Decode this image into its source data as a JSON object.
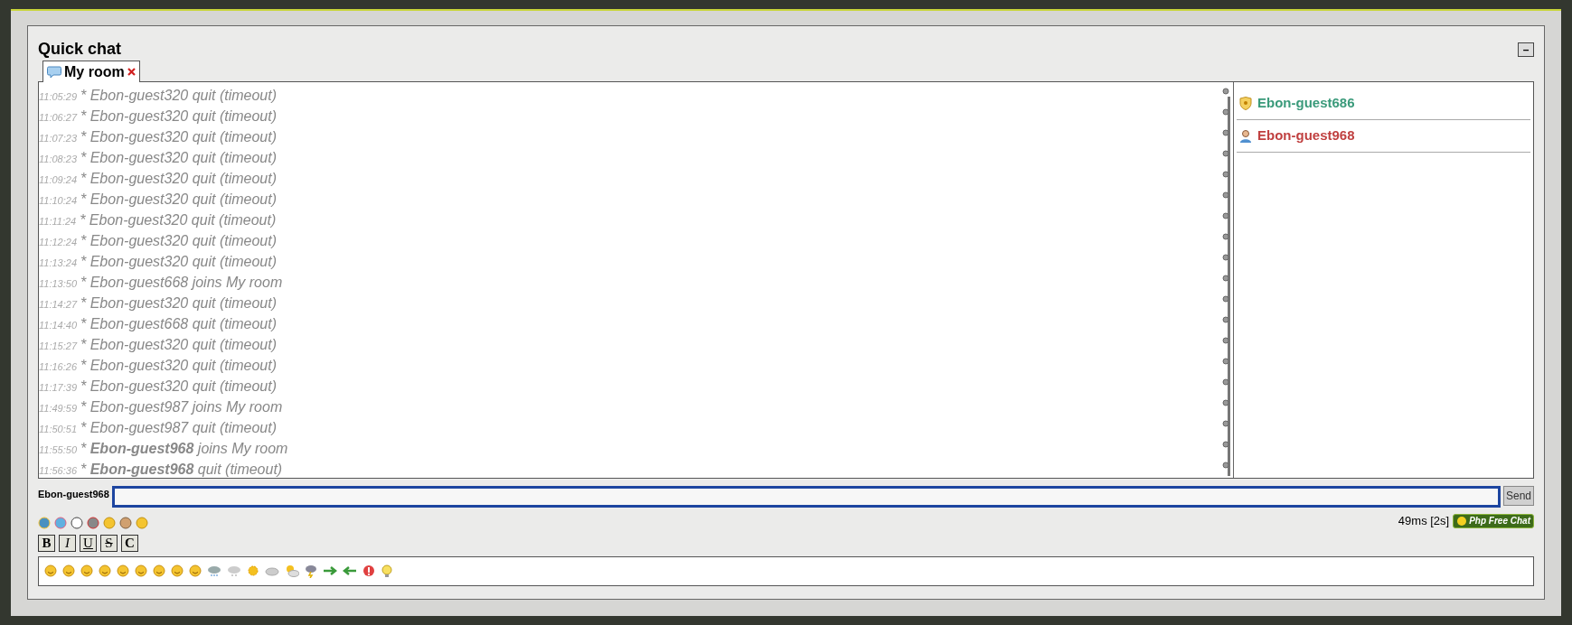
{
  "window": {
    "title": "Quick chat",
    "minimize": "–"
  },
  "tabs": [
    {
      "label": "My room",
      "selected": true
    }
  ],
  "messages": [
    {
      "time": "11:05:29",
      "text": "* Ebon-guest320 quit (timeout)"
    },
    {
      "time": "11:06:27",
      "text": "* Ebon-guest320 quit (timeout)"
    },
    {
      "time": "11:07:23",
      "text": "* Ebon-guest320 quit (timeout)"
    },
    {
      "time": "11:08:23",
      "text": "* Ebon-guest320 quit (timeout)"
    },
    {
      "time": "11:09:24",
      "text": "* Ebon-guest320 quit (timeout)"
    },
    {
      "time": "11:10:24",
      "text": "* Ebon-guest320 quit (timeout)"
    },
    {
      "time": "11:11:24",
      "text": "* Ebon-guest320 quit (timeout)"
    },
    {
      "time": "11:12:24",
      "text": "* Ebon-guest320 quit (timeout)"
    },
    {
      "time": "11:13:24",
      "text": "* Ebon-guest320 quit (timeout)"
    },
    {
      "time": "11:13:50",
      "text": "* Ebon-guest668 joins My room"
    },
    {
      "time": "11:14:27",
      "text": "* Ebon-guest320 quit (timeout)"
    },
    {
      "time": "11:14:40",
      "text": "* Ebon-guest668 quit (timeout)"
    },
    {
      "time": "11:15:27",
      "text": "* Ebon-guest320 quit (timeout)"
    },
    {
      "time": "11:16:26",
      "text": "* Ebon-guest320 quit (timeout)"
    },
    {
      "time": "11:17:39",
      "text": "* Ebon-guest320 quit (timeout)"
    },
    {
      "time": "11:49:59",
      "text": "* Ebon-guest987 joins My room"
    },
    {
      "time": "11:50:51",
      "text": "* Ebon-guest987 quit (timeout)"
    },
    {
      "time": "11:55:50",
      "text": "* **Ebon-guest968** joins My room"
    },
    {
      "time": "11:56:36",
      "text": "* **Ebon-guest968** quit (timeout)"
    }
  ],
  "users": [
    {
      "name": "Ebon-guest686",
      "kind": "admin",
      "color": "#3a9a7a"
    },
    {
      "name": "Ebon-guest968",
      "kind": "user",
      "color": "#c04040"
    }
  ],
  "input": {
    "nickname": "Ebon-guest968",
    "send": "Send"
  },
  "status": {
    "ping": "49ms [2s]",
    "logo": "Php Free Chat"
  },
  "format_buttons": [
    {
      "label": "B",
      "kind": "bold"
    },
    {
      "label": "I",
      "kind": "italic"
    },
    {
      "label": "U",
      "kind": "underline"
    },
    {
      "label": "S",
      "kind": "strike"
    },
    {
      "label": "C",
      "kind": "color"
    }
  ]
}
